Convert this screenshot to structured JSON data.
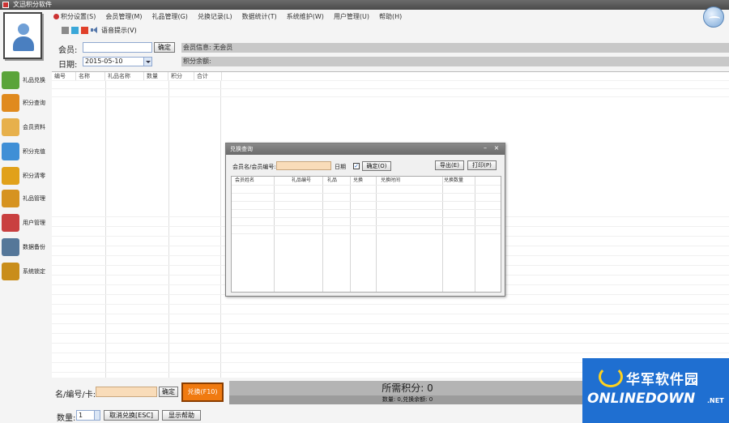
{
  "window": {
    "title": "文迅积分软件"
  },
  "menu": [
    "积分设置(S)",
    "会员管理(M)",
    "礼品管理(G)",
    "兑换记录(L)",
    "数据统计(T)",
    "系统维护(W)",
    "用户管理(U)",
    "帮助(H)"
  ],
  "toolbar": {
    "voice_label": "语音提示(V)"
  },
  "member_form": {
    "member_label": "会员:",
    "confirm_label": "确定",
    "date_label": "日期:",
    "date_value": "2015-05-10",
    "member_info_label": "会员信息: 无会员",
    "card_label": "积分余额:"
  },
  "nav": [
    {
      "label": "礼品兑换",
      "color": "#5aa43a"
    },
    {
      "label": "积分查询",
      "color": "#e08a1e"
    },
    {
      "label": "会员资料",
      "color": "#e7b04b"
    },
    {
      "label": "积分充值",
      "color": "#3f8fd6"
    },
    {
      "label": "积分清零",
      "color": "#e1a11a"
    },
    {
      "label": "礼品管理",
      "color": "#d69320"
    },
    {
      "label": "用户管理",
      "color": "#c94040"
    },
    {
      "label": "数据备份",
      "color": "#557799"
    },
    {
      "label": "系统锁定",
      "color": "#c98d1a"
    }
  ],
  "grid_headers": [
    "编号",
    "名称",
    "礼品名称",
    "数量",
    "积分",
    "合计"
  ],
  "dialog": {
    "title": "兑换查询",
    "search_label": "会员名/会员编号:",
    "checkbox_label": "日期",
    "confirm_label": "确定(O)",
    "export_label": "导出(E)",
    "print_label": "打印(P)",
    "columns": [
      "会员姓名",
      "礼品编号",
      "礼品",
      "兑换",
      "兑换时间",
      "兑换数量"
    ]
  },
  "bottom": {
    "name_label": "名/编号/卡:",
    "confirm_label": "确定",
    "redeem_label": "兑换(F10)",
    "points_text": "所需积分: 0",
    "status_text": "数量: 0,兑换余额: 0",
    "qty_label": "数量:",
    "qty_value": "1",
    "cancel_label": "取消兑换[ESC]",
    "help_label": "显示帮助"
  },
  "watermark": {
    "chinese": "华军软件园",
    "english": "ONLINEDOWN",
    "suffix": ".NET"
  }
}
